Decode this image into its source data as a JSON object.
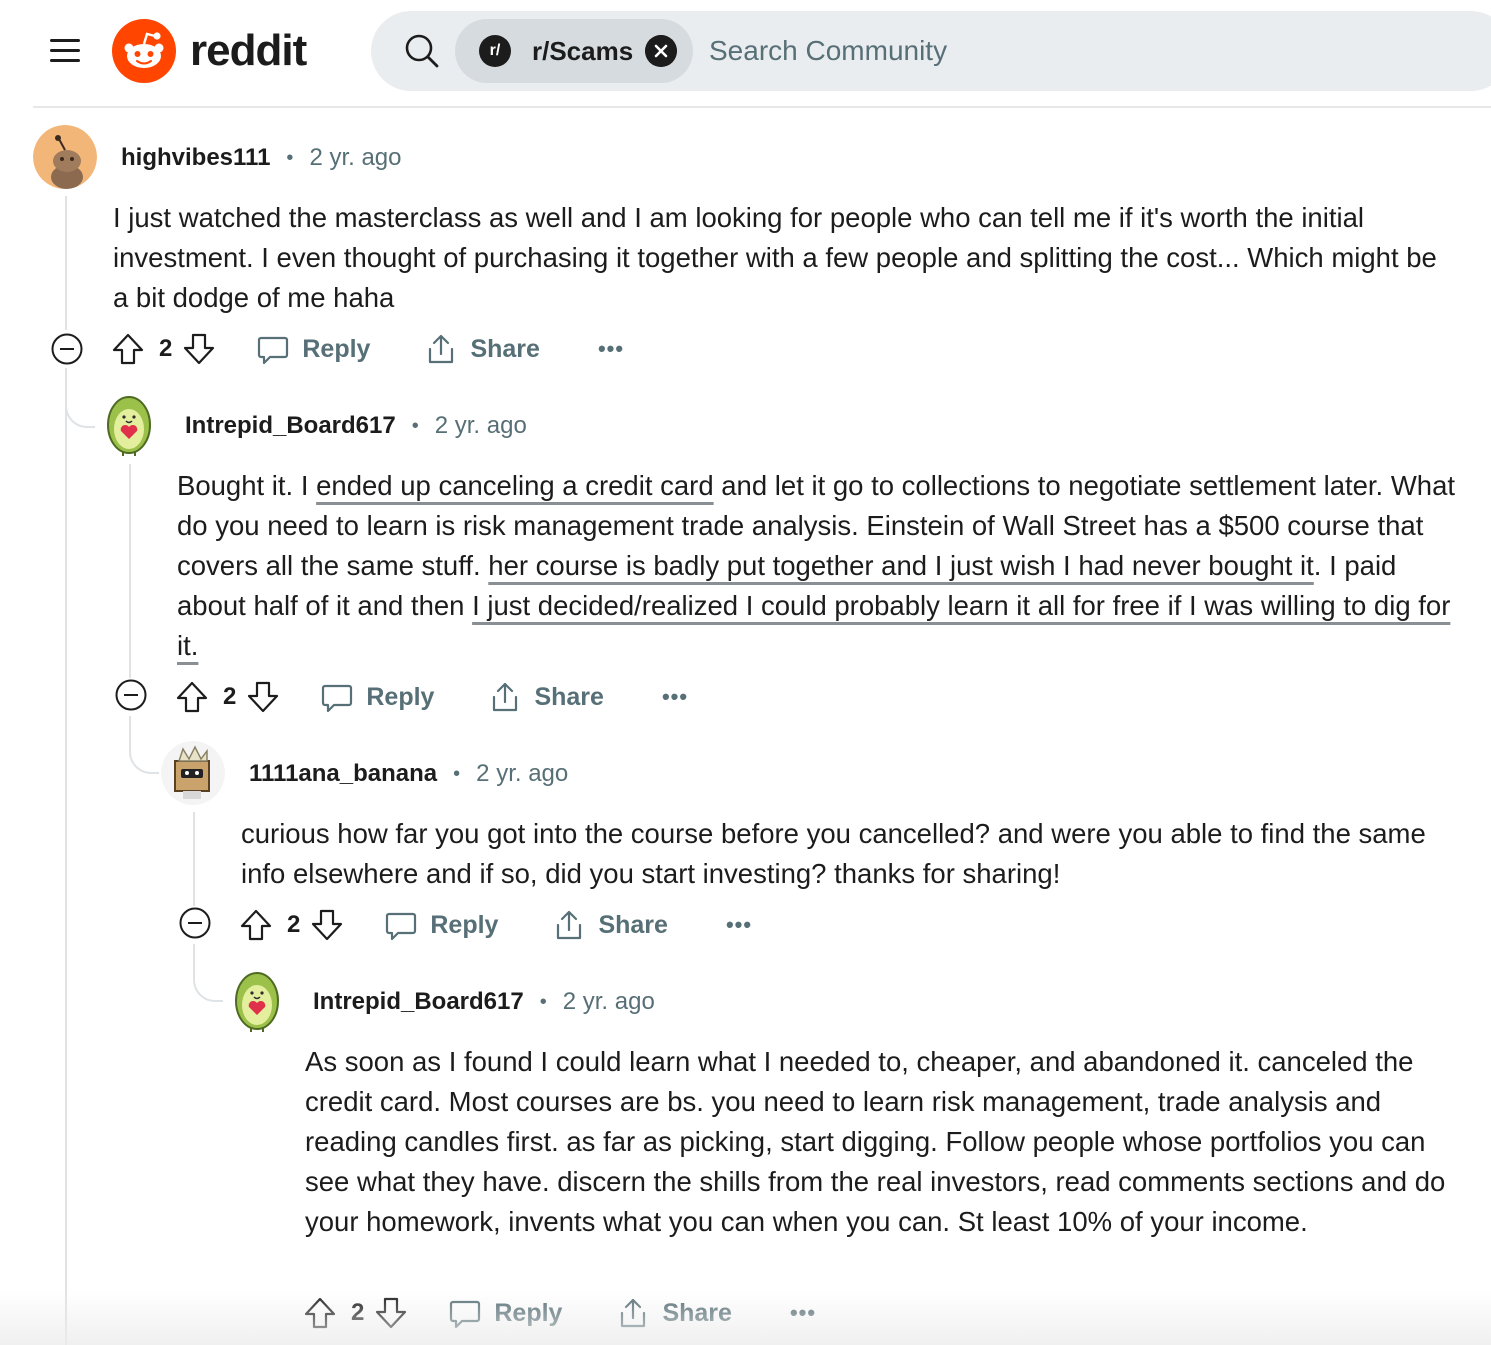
{
  "header": {
    "logo_text": "reddit",
    "community_chip": {
      "avatar_text": "r/",
      "label": "r/Scams"
    },
    "search_placeholder": "Search Community",
    "colors": {
      "brand": "#ff4500",
      "search_bg": "#eaedef",
      "chip_bg": "#d6dbdf"
    }
  },
  "comments": [
    {
      "username": "highvibes111",
      "separator": "•",
      "time": "2 yr. ago",
      "body": [
        {
          "text": "I just watched the masterclass as well and I am looking for people who can tell me if it's worth the initial investment. I even thought of purchasing it together with a few people and splitting the cost... Which might be a bit dodge of me haha",
          "underlined": false
        }
      ],
      "votes": "2",
      "reply_label": "Reply",
      "share_label": "Share",
      "more_label": "•••"
    },
    {
      "username": "Intrepid_Board617",
      "separator": "•",
      "time": "2 yr. ago",
      "body": [
        {
          "text": "Bought it. I ",
          "underlined": false
        },
        {
          "text": "ended up canceling a credit card",
          "underlined": true
        },
        {
          "text": " and let it go to collections to negotiate settlement later. What do you need to learn is risk management trade analysis. Einstein of Wall Street has a $500 course that covers all the same stuff. ",
          "underlined": false
        },
        {
          "text": "her course is badly put together and I just wish I had never bought it",
          "underlined": true
        },
        {
          "text": ". I paid about half of it and then ",
          "underlined": false
        },
        {
          "text": "I just decided/realized I could probably learn it all for free if I was willing to dig for it.",
          "underlined": true
        }
      ],
      "votes": "2",
      "reply_label": "Reply",
      "share_label": "Share",
      "more_label": "•••"
    },
    {
      "username": "1111ana_banana",
      "separator": "•",
      "time": "2 yr. ago",
      "body": [
        {
          "text": "curious how far you got into the course before you cancelled? and were you able to find the same info elsewhere and if so, did you start investing? thanks for sharing!",
          "underlined": false
        }
      ],
      "votes": "2",
      "reply_label": "Reply",
      "share_label": "Share",
      "more_label": "•••"
    },
    {
      "username": "Intrepid_Board617",
      "separator": "•",
      "time": "2 yr. ago",
      "body": [
        {
          "text": "As soon as I found I could learn what I needed to, cheaper, and abandoned it. canceled the credit card. Most courses are bs. you need to learn risk management, trade analysis and reading candles first. as far as picking, start digging. Follow people whose portfolios you can see what they have. discern the shills from the real investors, read comments sections and do your homework, invents what you can when you can. St least 10% of your income.",
          "underlined": false
        }
      ],
      "votes": "2",
      "reply_label": "Reply",
      "share_label": "Share",
      "more_label": "•••"
    }
  ]
}
